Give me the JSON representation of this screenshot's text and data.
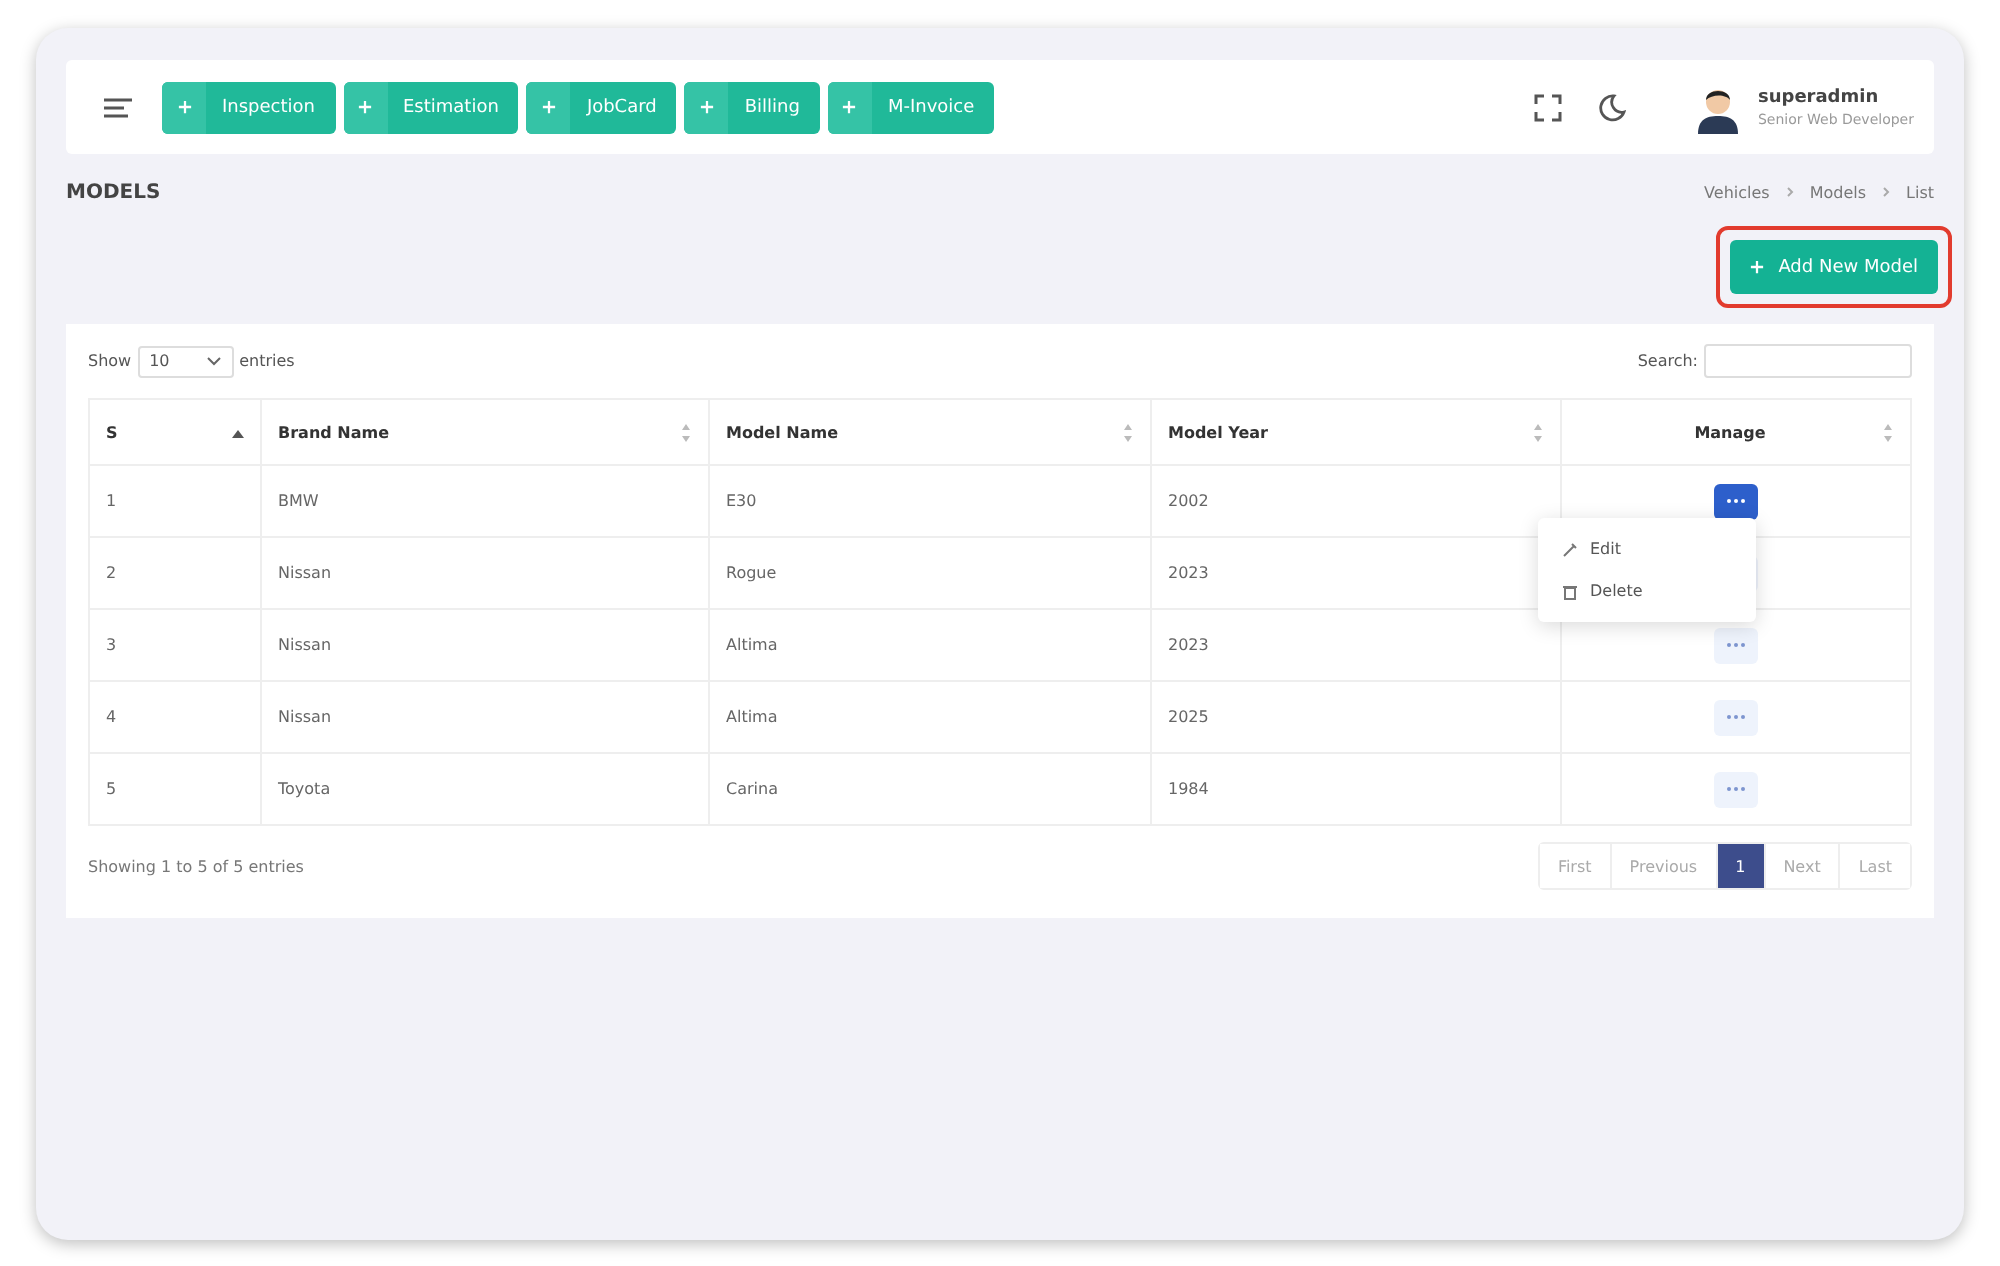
{
  "header": {
    "quick_actions": [
      {
        "label": "Inspection"
      },
      {
        "label": "Estimation"
      },
      {
        "label": "JobCard"
      },
      {
        "label": "Billing"
      },
      {
        "label": "M-Invoice"
      }
    ],
    "user": {
      "name": "superadmin",
      "role": "Senior Web Developer"
    }
  },
  "page": {
    "title": "MODELS",
    "breadcrumb": [
      "Vehicles",
      "Models",
      "List"
    ]
  },
  "add_button": {
    "label": "Add New Model",
    "highlighted": true
  },
  "table": {
    "length_label_before": "Show",
    "length_value": "10",
    "length_label_after": "entries",
    "search_label": "Search:",
    "columns": [
      {
        "label": "S",
        "sorted": true
      },
      {
        "label": "Brand Name",
        "sorted": false
      },
      {
        "label": "Model Name",
        "sorted": false
      },
      {
        "label": "Model Year",
        "sorted": false
      },
      {
        "label": "Manage",
        "sorted": false
      }
    ],
    "rows": [
      {
        "cells": [
          "1",
          "BMW",
          "E30",
          "2002"
        ],
        "menu_open": true
      },
      {
        "cells": [
          "2",
          "Nissan",
          "Rogue",
          "2023"
        ],
        "menu_open": false
      },
      {
        "cells": [
          "3",
          "Nissan",
          "Altima",
          "2023"
        ],
        "menu_open": false
      },
      {
        "cells": [
          "4",
          "Nissan",
          "Altima",
          "2025"
        ],
        "menu_open": false
      },
      {
        "cells": [
          "5",
          "Toyota",
          "Carina",
          "1984"
        ],
        "menu_open": false
      }
    ],
    "row_menu": [
      {
        "label": "Edit",
        "kind": "edit"
      },
      {
        "label": "Delete",
        "kind": "delete"
      }
    ],
    "info": "Showing 1 to 5 of 5 entries",
    "pagination": [
      {
        "label": "First",
        "selected": false
      },
      {
        "label": "Previous",
        "selected": false
      },
      {
        "label": "1",
        "selected": true
      },
      {
        "label": "Next",
        "selected": false
      },
      {
        "label": "Last",
        "selected": false
      }
    ]
  }
}
